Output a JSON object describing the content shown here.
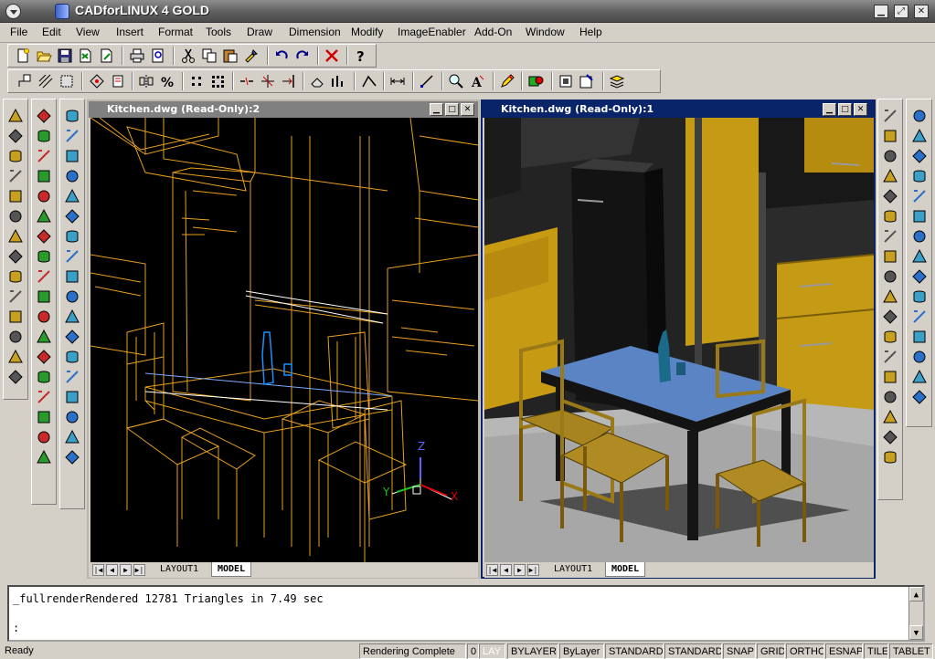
{
  "app": {
    "title": "CADforLINUX 4 GOLD"
  },
  "menu": [
    "File",
    "Edit",
    "View",
    "Insert",
    "Format",
    "Tools",
    "Draw",
    "Dimension",
    "Modify",
    "ImageEnabler",
    "Add-On",
    "Window",
    "Help"
  ],
  "viewports": {
    "left": {
      "title": "Kitchen.dwg (Read-Only):2",
      "tabs": [
        "LAYOUT1",
        "MODEL"
      ],
      "axes": {
        "x": "X",
        "y": "Y",
        "z": "Z"
      }
    },
    "right": {
      "title": "Kitchen.dwg (Read-Only):1",
      "tabs": [
        "LAYOUT1",
        "MODEL"
      ]
    }
  },
  "command": {
    "line1": "_fullrenderRendered 12781 Triangles in 7.49 sec",
    "prompt": ":"
  },
  "status": {
    "ready": "Ready",
    "render": "Rendering Complete",
    "layer": "0",
    "lay": "LAY",
    "color": "BYLAYER",
    "linetype": "ByLayer",
    "textstyle": "STANDARD",
    "dimstyle": "STANDARD",
    "toggles": [
      "SNAP",
      "GRID",
      "ORTHO",
      "ESNAP",
      "TILE",
      "TABLET"
    ]
  },
  "colors": {
    "wireframe": "#f0a020",
    "active_title": "#0a246a",
    "inactive_title": "#808080",
    "bottle": "#1a90ff"
  }
}
